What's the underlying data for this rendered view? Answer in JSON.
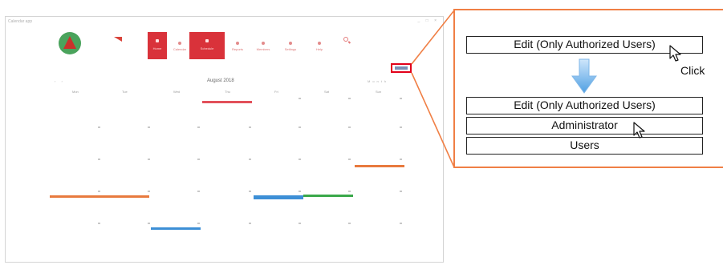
{
  "app": {
    "title": "Calendar app",
    "window_controls": "_ □ ×",
    "brand": "",
    "nav": [
      {
        "label": "Home"
      },
      {
        "label": "Calendar"
      },
      {
        "label": "Schedule"
      },
      {
        "label": "Reports"
      },
      {
        "label": "Members"
      },
      {
        "label": "Settings"
      },
      {
        "label": "Help"
      }
    ],
    "calendar": {
      "month": "August 2018",
      "prev_controls": "‹ ›",
      "view_controls": "Month",
      "weekdays": [
        "Mon",
        "Tue",
        "Wed",
        "Thu",
        "Fri",
        "Sat",
        "Sun"
      ]
    }
  },
  "callout": {
    "border_color": "#f07f45",
    "before_option": "Edit (Only Authorized Users)",
    "click_label": "Click",
    "menu": {
      "options": [
        "Edit (Only Authorized Users)",
        "Administrator",
        "Users"
      ]
    }
  },
  "colors": {
    "accent_red": "#d9323a",
    "event_orange": "#e87a3e",
    "event_blue": "#3d8fd6",
    "event_green": "#3aa84a",
    "event_red": "#e2505a",
    "arrow_blue": "#5aa9e6"
  },
  "icons": {
    "cursor": "mouse-pointer-icon",
    "down_arrow": "down-arrow-icon",
    "search": "search-icon"
  }
}
